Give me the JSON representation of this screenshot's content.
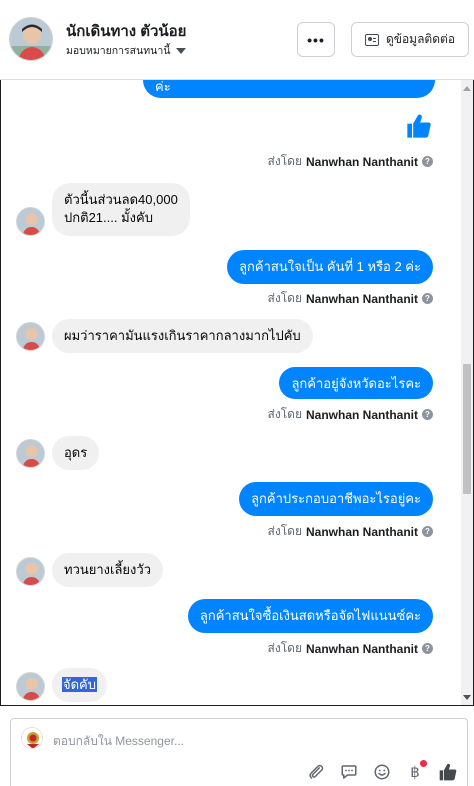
{
  "header": {
    "name": "นักเดินทาง ตัวน้อย",
    "assignment": "มอบหมายการสนทนานี้",
    "more_label": "•••",
    "contact_label": "ดูข้อมูลติดต่อ"
  },
  "conversation": {
    "top_partial_bubble": "ค่ะ",
    "messages": [
      {
        "dir": "out",
        "kind": "like-sticker",
        "sent_by_prefix": "ส่งโดย",
        "sent_by_name": "Nanwhan Nanthanit"
      },
      {
        "dir": "in",
        "line1": "ตัวนี้นส่วนลด40,000",
        "line2": "ปกติ21.... มั้งคับ"
      },
      {
        "dir": "out",
        "text": "ลูกค้าสนใจเป็น คันที่ 1 หรือ 2 ค่ะ",
        "sent_by_prefix": "ส่งโดย",
        "sent_by_name": "Nanwhan Nanthanit"
      },
      {
        "dir": "in",
        "text": "ผมว่าราคามันแรงเกินราคากลางมากไปคับ"
      },
      {
        "dir": "out",
        "text": "ลูกค้าอยู่จังหวัดอะไรคะ",
        "sent_by_prefix": "ส่งโดย",
        "sent_by_name": "Nanwhan Nanthanit"
      },
      {
        "dir": "in",
        "text": "อุดร"
      },
      {
        "dir": "out",
        "text": "ลูกค้าประกอบอาชีพอะไรอยู่คะ",
        "sent_by_prefix": "ส่งโดย",
        "sent_by_name": "Nanwhan Nanthanit"
      },
      {
        "dir": "in",
        "text": "ทวนยางเลี้ยงวัว"
      },
      {
        "dir": "out",
        "text": "ลูกค้าสนใจซื้อเงินสดหรือจัดไฟแนนซ์คะ",
        "sent_by_prefix": "ส่งโดย",
        "sent_by_name": "Nanwhan Nanthanit"
      },
      {
        "dir": "in",
        "text": "จัดคับ",
        "selected": true
      }
    ]
  },
  "composer": {
    "placeholder": "ตอบกลับใน Messenger...",
    "tools": [
      "paperclip-icon",
      "speech-bubble-icon",
      "emoji-icon",
      "baht-payment-icon",
      "like-icon"
    ],
    "baht_symbol": "฿"
  },
  "colors": {
    "accent": "#0084ff",
    "incoming_bubble": "#f1f0f0",
    "notification_dot": "#f02849"
  }
}
